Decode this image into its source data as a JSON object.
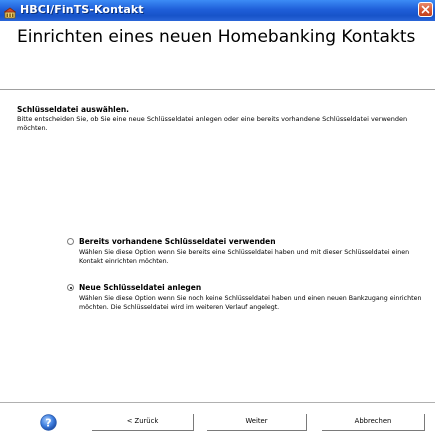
{
  "window": {
    "title": "HBCI/FinTS-Kontakt",
    "app_icon": "hbci-app-icon",
    "close_icon": "close-icon"
  },
  "header": {
    "heading": "Einrichten eines neuen Homebanking Kontakts"
  },
  "section": {
    "title": "Schlüsseldatei auswählen.",
    "description": "Bitte entscheiden Sie, ob Sie eine neue Schlüsseldatei anlegen oder eine bereits vorhandene Schlüsseldatei verwenden möchten."
  },
  "options": [
    {
      "label": "Bereits vorhandene Schlüsseldatei verwenden",
      "description": "Wählen Sie diese Option wenn Sie bereits eine Schlüsseldatei haben und mit dieser Schlüsseldatei einen Kontakt einrichten möchten.",
      "selected": false
    },
    {
      "label": "Neue Schlüsseldatei anlegen",
      "description": "Wählen Sie diese Option wenn Sie noch keine Schlüsseldatei haben und einen neuen Bankzugang einrichten möchten. Die Schlüsseldatei wird im weiteren Verlauf angelegt.",
      "selected": true
    }
  ],
  "footer": {
    "help_icon": "help-icon",
    "back_label": "< Zurück",
    "next_label": "Weiter",
    "cancel_label": "Abbrechen"
  },
  "colors": {
    "titlebar": "#1f5fd9",
    "close_button": "#d6532e",
    "help_icon": "#2f6fd1"
  }
}
